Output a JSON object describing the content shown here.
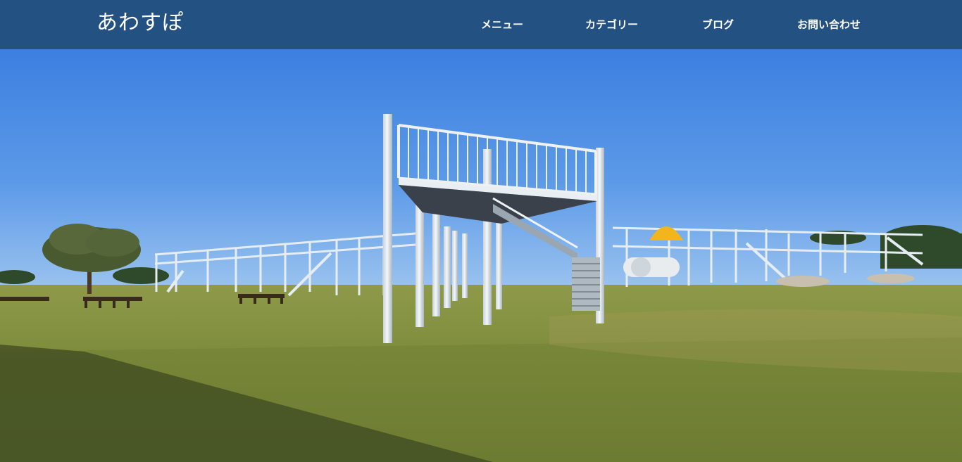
{
  "header": {
    "logo_text": "あわすぽ",
    "background_color": "#235182",
    "text_color": "#ffffff"
  },
  "nav": {
    "items": [
      {
        "label": "メニュー"
      },
      {
        "label": "カテゴリー"
      },
      {
        "label": "ブログ"
      },
      {
        "label": "お問い合わせ"
      }
    ]
  },
  "hero": {
    "subject": "playground tower with white railings on a grassy park field under a clear blue sky",
    "icon": "hero-photo"
  }
}
